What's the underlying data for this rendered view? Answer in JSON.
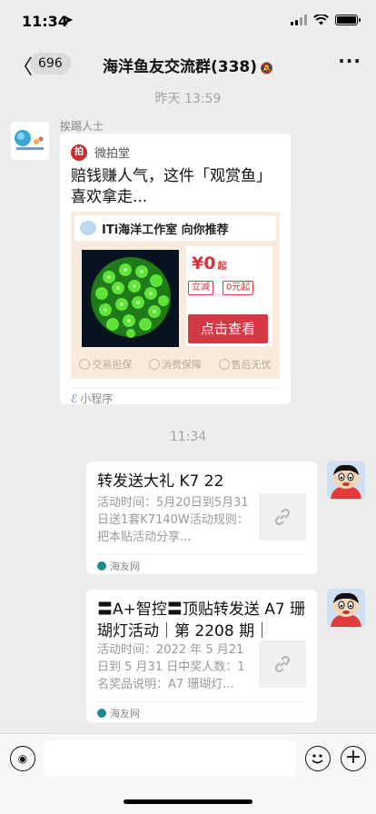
{
  "status_bar": {
    "time": "11:34",
    "location_icon": "location-arrow-icon"
  },
  "nav": {
    "back_icon": "chevron-left-icon",
    "unread_count": "696",
    "title": "海洋鱼友交流群(338)",
    "mute_icon": "bell-muted-icon",
    "more_icon": "more-dots-icon"
  },
  "timestamps": {
    "first": "昨天 13:59",
    "second": "11:34"
  },
  "messages": {
    "left": {
      "sender": "挨踢人士",
      "app_name": "微拍堂",
      "title": "赔钱赚人气，这件「观赏鱼」喜欢拿走...",
      "shop": "ITi海洋工作室 向你推荐",
      "price_symbol": "¥",
      "price": "0",
      "price_suffix": "起",
      "tag1": "立减",
      "tag2": "0元起",
      "view_button": "点击查看",
      "guarantees": [
        "交易担保",
        "消费保障",
        "售后无忧"
      ],
      "footer": "小程序"
    },
    "right1": {
      "title": "转发送大礼 K7 22",
      "desc": "活动时间：5月20日到5月31日送1套K7140W活动规则：把本贴活动分享...",
      "source": "海友网"
    },
    "right2": {
      "title": "〓A+智控〓顶贴转发送 A7 珊瑚灯活动｜第 2208 期｜",
      "desc": "活动时间：2022 年 5 月21 日到 5 月31 日中奖人数：1 名奖品说明：A7 珊瑚灯...",
      "source": "海友网"
    }
  },
  "input_bar": {
    "placeholder": ""
  },
  "colors": {
    "background": "#ededed",
    "accent_red": "#d13a45",
    "card": "#ffffff"
  }
}
